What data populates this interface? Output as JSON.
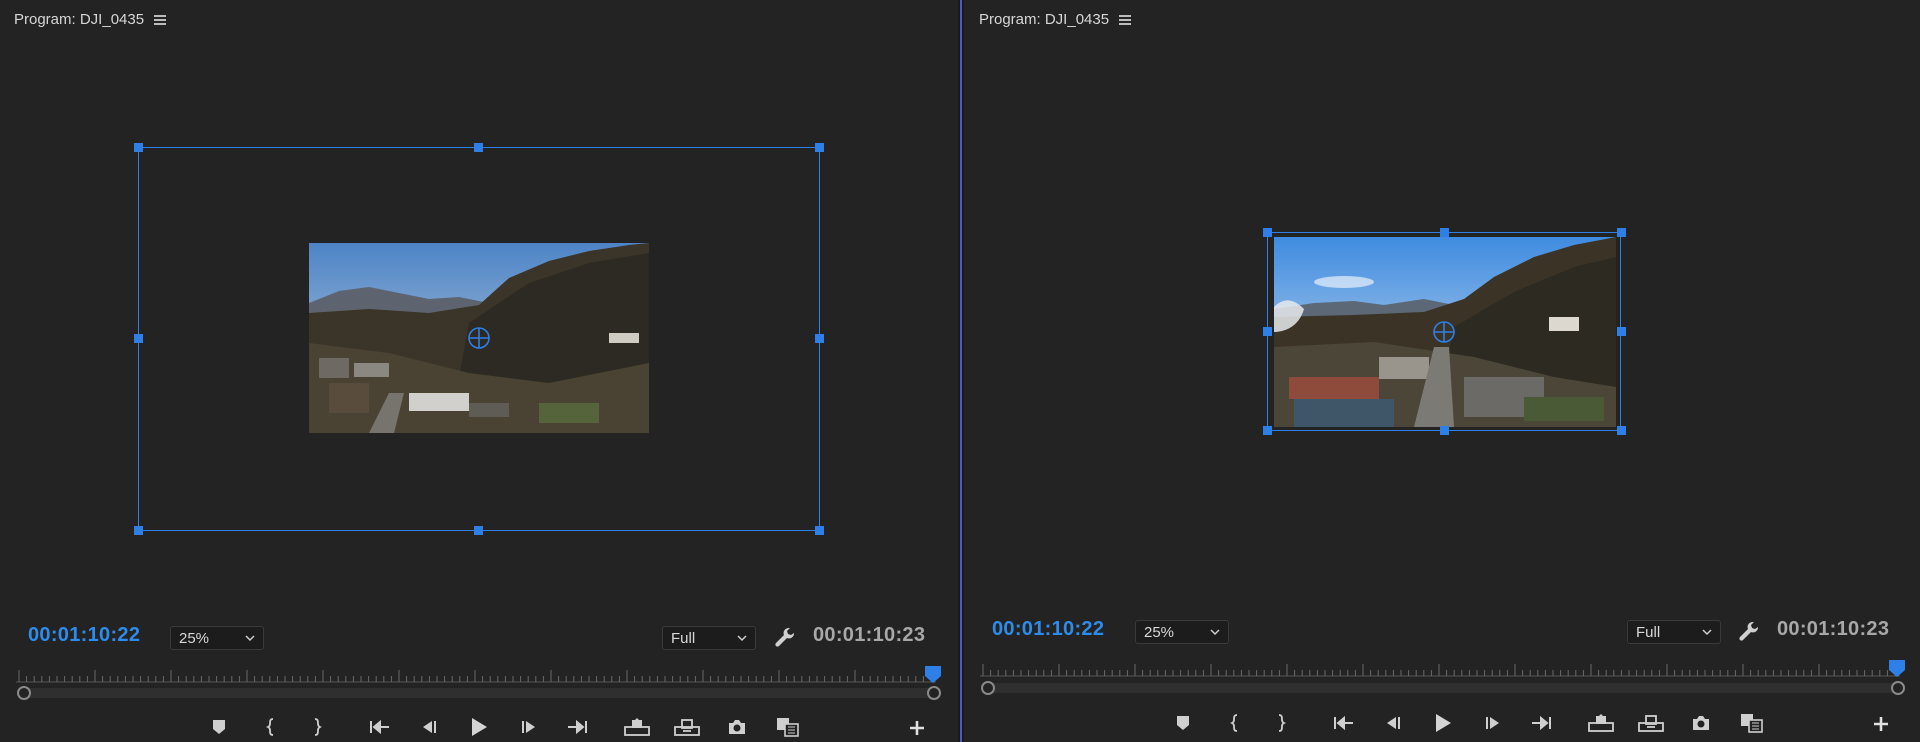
{
  "left_panel": {
    "title": "Program: DJI_0435",
    "timecode_current": "00:01:10:22",
    "zoom_level": "25%",
    "resolution": "Full",
    "timecode_duration": "00:01:10:23"
  },
  "right_panel": {
    "title": "Program: DJI_0435",
    "timecode_current": "00:01:10:22",
    "zoom_level": "25%",
    "resolution": "Full",
    "timecode_duration": "00:01:10:23"
  },
  "icons": {
    "menu": "hamburger-menu-icon",
    "settings": "wrench-icon",
    "transport": [
      "add-marker-icon",
      "mark-in-icon",
      "mark-out-icon",
      "go-to-in-icon",
      "step-back-icon",
      "play-icon",
      "step-forward-icon",
      "go-to-out-icon",
      "lift-icon",
      "extract-icon",
      "export-frame-icon",
      "comparison-view-icon",
      "button-editor-plus-icon"
    ]
  },
  "colors": {
    "accent": "#2d8ceb",
    "selection": "#2f80e6",
    "panel_bg": "#232323",
    "splitter": "#4a5dbf"
  }
}
